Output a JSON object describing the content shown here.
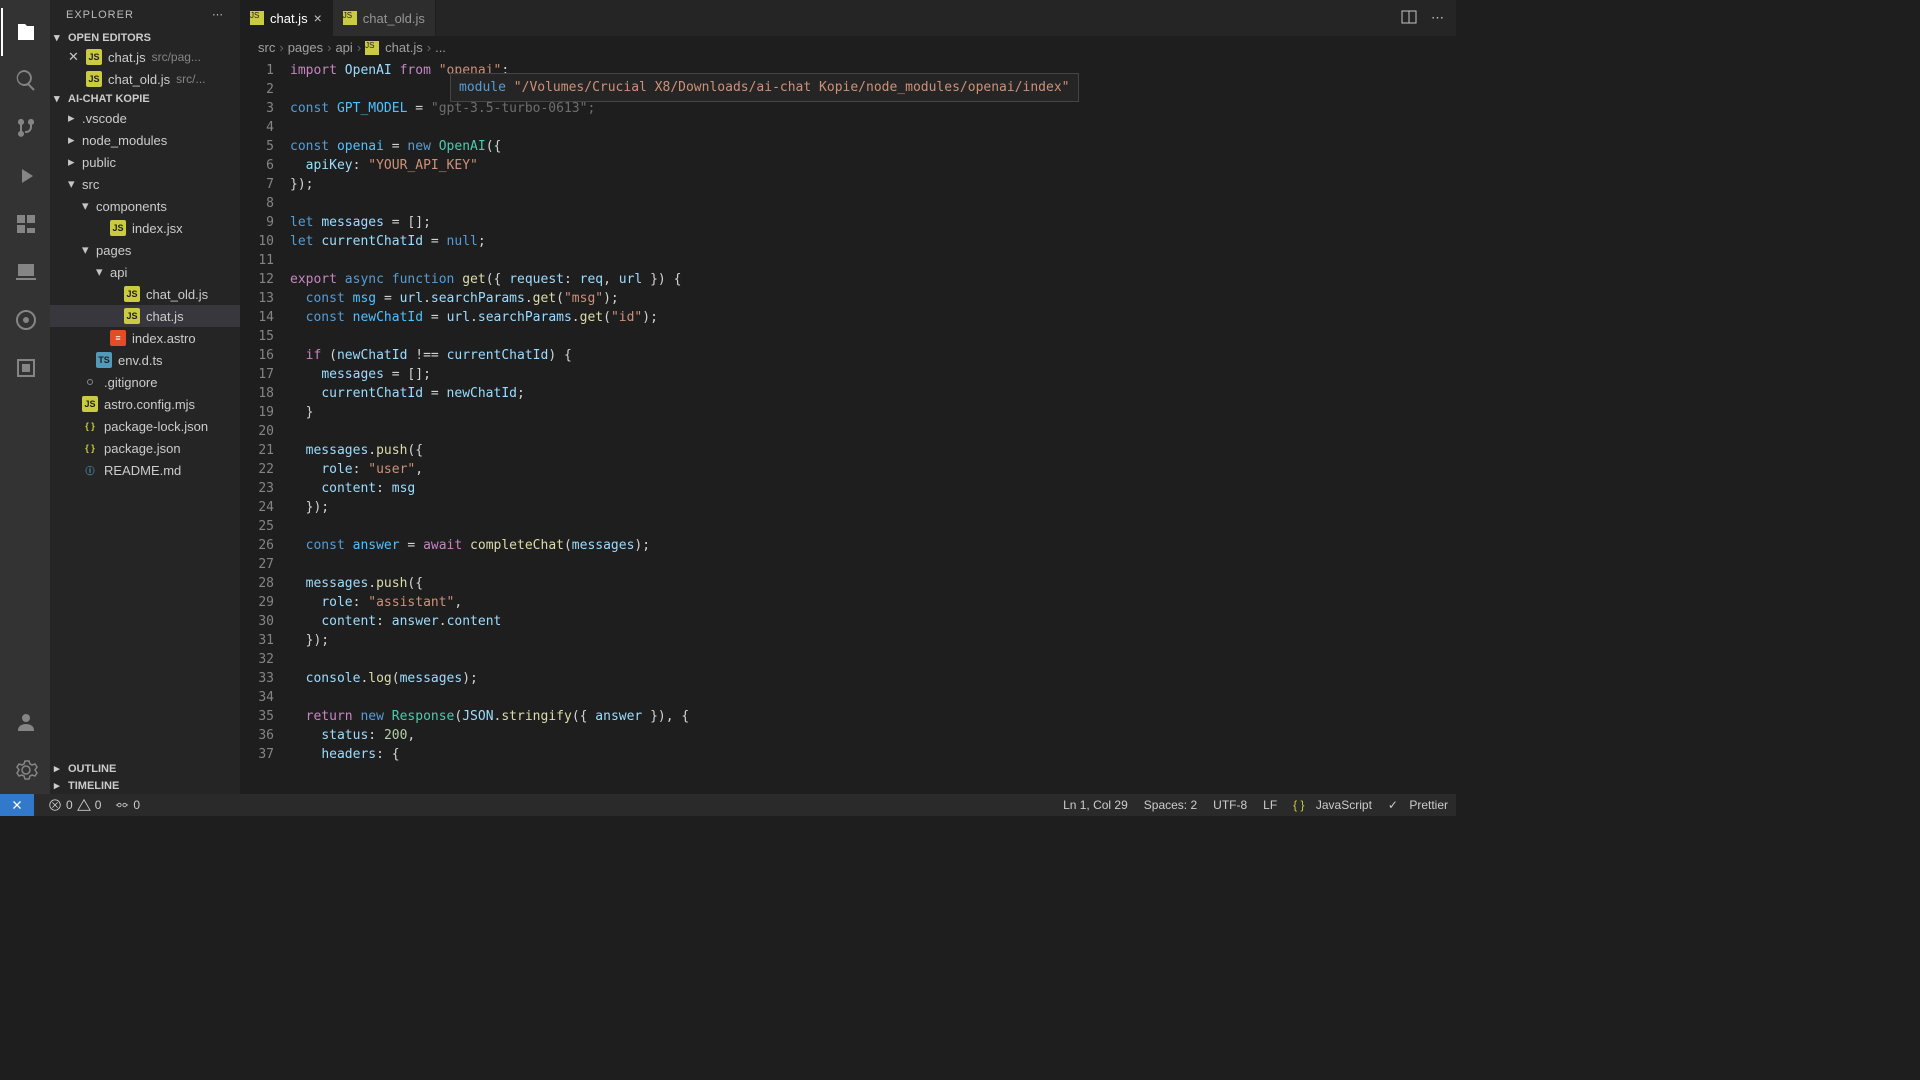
{
  "sidebar": {
    "title": "EXPLORER",
    "sections": {
      "openEditors": {
        "label": "OPEN EDITORS",
        "items": [
          {
            "name": "chat.js",
            "path": "src/pag...",
            "modified": true
          },
          {
            "name": "chat_old.js",
            "path": "src/..."
          }
        ]
      },
      "project": {
        "label": "AI-CHAT KOPIE",
        "tree": [
          {
            "name": ".vscode",
            "type": "folder",
            "indent": 1
          },
          {
            "name": "node_modules",
            "type": "folder",
            "indent": 1
          },
          {
            "name": "public",
            "type": "folder",
            "indent": 1
          },
          {
            "name": "src",
            "type": "folder",
            "indent": 1,
            "open": true
          },
          {
            "name": "components",
            "type": "folder",
            "indent": 2,
            "open": true
          },
          {
            "name": "index.jsx",
            "type": "js",
            "indent": 3
          },
          {
            "name": "pages",
            "type": "folder",
            "indent": 2,
            "open": true
          },
          {
            "name": "api",
            "type": "folder",
            "indent": 3,
            "open": true
          },
          {
            "name": "chat_old.js",
            "type": "js",
            "indent": 4
          },
          {
            "name": "chat.js",
            "type": "js",
            "indent": 4,
            "selected": true
          },
          {
            "name": "index.astro",
            "type": "astro",
            "indent": 3
          },
          {
            "name": "env.d.ts",
            "type": "ts",
            "indent": 2
          },
          {
            "name": ".gitignore",
            "type": "dot",
            "indent": 1
          },
          {
            "name": "astro.config.mjs",
            "type": "js",
            "indent": 1
          },
          {
            "name": "package-lock.json",
            "type": "json",
            "indent": 1
          },
          {
            "name": "package.json",
            "type": "json",
            "indent": 1
          },
          {
            "name": "README.md",
            "type": "info",
            "indent": 1
          }
        ]
      },
      "outline": "OUTLINE",
      "timeline": "TIMELINE"
    }
  },
  "tabs": [
    {
      "name": "chat.js",
      "active": true
    },
    {
      "name": "chat_old.js",
      "active": false
    }
  ],
  "breadcrumb": [
    "src",
    "pages",
    "api",
    "chat.js",
    "..."
  ],
  "hover": {
    "keyword": "module",
    "path": "\"/Volumes/Crucial X8/Downloads/ai-chat Kopie/node_modules/openai/index\""
  },
  "code": {
    "lines": 37,
    "gpt_model": "\"gpt-3.5-turbo-0613\"",
    "api_key": "\"YOUR_API_KEY\""
  },
  "statusbar": {
    "errors": "0",
    "warnings": "0",
    "ports": "0",
    "cursor": "Ln 1, Col 29",
    "spaces": "Spaces: 2",
    "encoding": "UTF-8",
    "eol": "LF",
    "lang": "JavaScript",
    "prettier": "Prettier"
  }
}
